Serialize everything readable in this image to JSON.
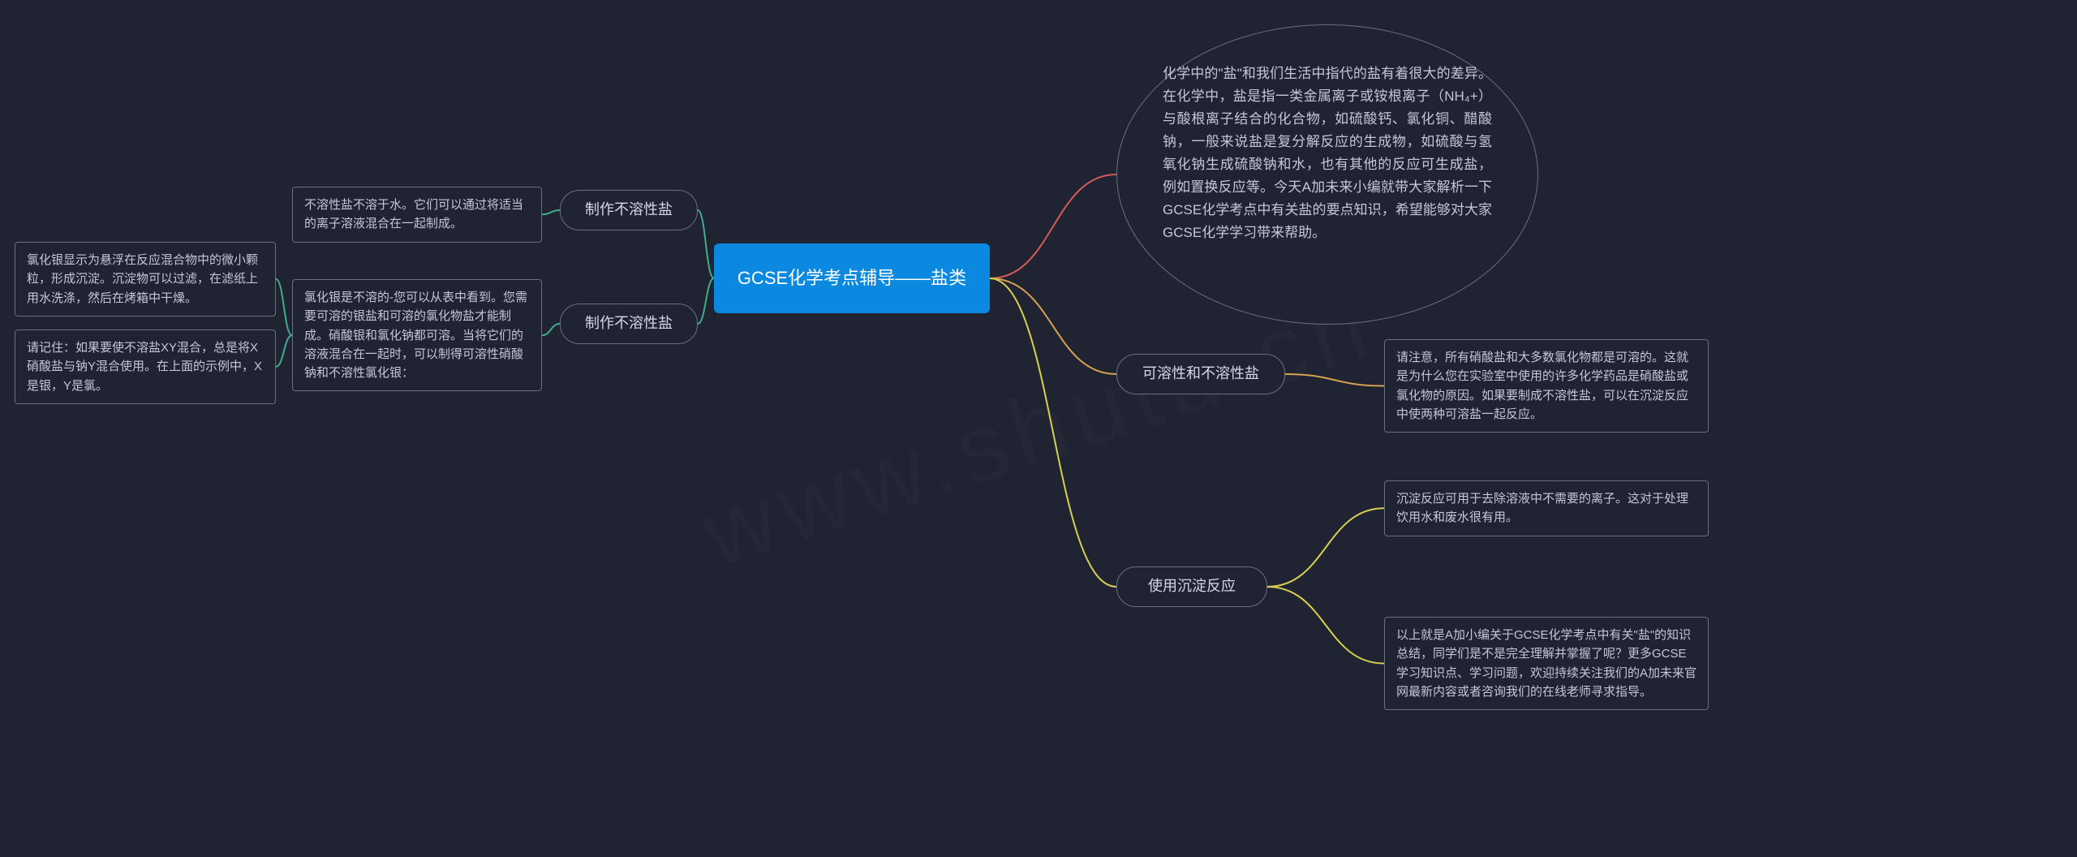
{
  "root": {
    "title": "GCSE化学考点辅导——盐类"
  },
  "right": {
    "intro": {
      "text": "化学中的\"盐\"和我们生活中指代的盐有着很大的差异。在化学中，盐是指一类金属离子或铵根离子（NH₄+）与酸根离子结合的化合物，如硫酸钙、氯化铜、醋酸钠，一般来说盐是复分解反应的生成物，如硫酸与氢氧化钠生成硫酸钠和水，也有其他的反应可生成盐，例如置换反应等。今天A加未来小编就带大家解析一下GCSE化学考点中有关盐的要点知识，希望能够对大家GCSE化学学习带来帮助。"
    },
    "soluble": {
      "label": "可溶性和不溶性盐",
      "note": "请注意，所有硝酸盐和大多数氯化物都是可溶的。这就是为什么您在实验室中使用的许多化学药品是硝酸盐或氯化物的原因。如果要制成不溶性盐，可以在沉淀反应中使两种可溶盐一起反应。"
    },
    "precip": {
      "label": "使用沉淀反应",
      "note1": "沉淀反应可用于去除溶液中不需要的离子。这对于处理饮用水和废水很有用。",
      "note2": "以上就是A加小编关于GCSE化学考点中有关\"盐\"的知识总结，同学们是不是完全理解并掌握了呢？更多GCSE学习知识点、学习问题，欢迎持续关注我们的A加未来官网最新内容或者咨询我们的在线老师寻求指导。"
    }
  },
  "left": {
    "insoluble1": {
      "label": "制作不溶性盐",
      "note": "不溶性盐不溶于水。它们可以通过将适当的离子溶液混合在一起制成。"
    },
    "insoluble2": {
      "label": "制作不溶性盐",
      "note": "氯化银是不溶的-您可以从表中看到。您需要可溶的银盐和可溶的氯化物盐才能制成。硝酸银和氯化钠都可溶。当将它们的溶液混合在一起时，可以制得可溶性硝酸钠和不溶性氯化银：",
      "sub1": "氯化银显示为悬浮在反应混合物中的微小颗粒，形成沉淀。沉淀物可以过滤，在滤纸上用水洗涤，然后在烤箱中干燥。",
      "sub2": "请记住：如果要使不溶盐XY混合，总是将X硝酸盐与钠Y混合使用。在上面的示例中，X是银，Y是氯。"
    }
  },
  "colors": {
    "red": "#d45a5a",
    "orange": "#d6a24f",
    "yellow": "#d6cf4f",
    "green": "#3fae8a"
  }
}
